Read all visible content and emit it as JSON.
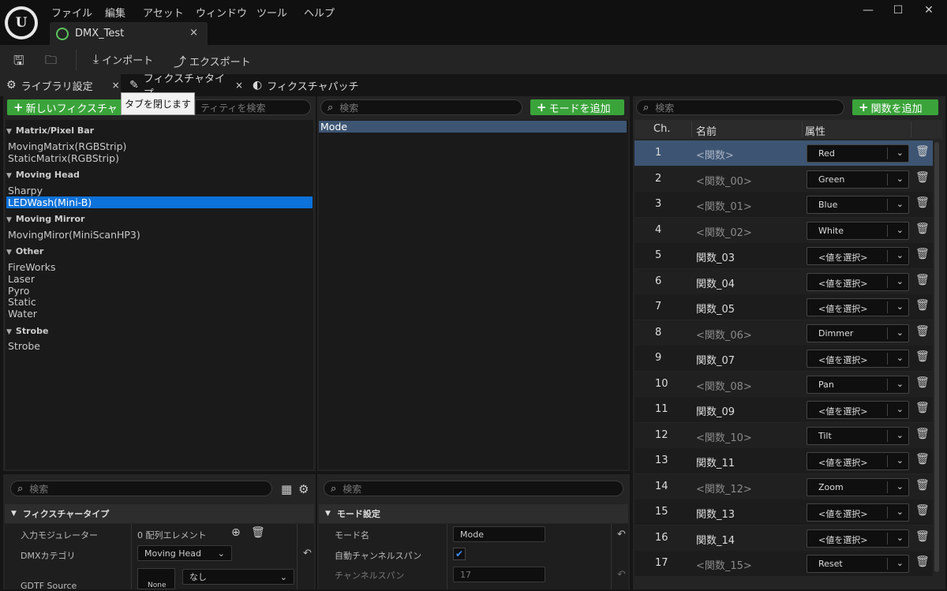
{
  "menu": [
    "ファイル",
    "編集",
    "アセット",
    "ウィンドウ",
    "ツール",
    "ヘルプ"
  ],
  "document_tab": {
    "label": "DMX_Test",
    "close": "×"
  },
  "window_buttons": {
    "minimize": "—",
    "maximize": "☐",
    "close": "✕"
  },
  "toolbar": {
    "import": "インポート",
    "export": "エクスポート"
  },
  "panel_tabs": [
    {
      "label": "ライブラリ設定",
      "close": "×"
    },
    {
      "label": "フィクスチャタイプ",
      "close": "×"
    },
    {
      "label": "フィクスチャパッチ"
    }
  ],
  "tooltip": "タブを閉じます",
  "fixture_list": {
    "new_button": "新しいフィクスチャ",
    "search_placeholder": "ティティを検索",
    "categories": [
      {
        "name": "Matrix/Pixel Bar",
        "items": [
          "MovingMatrix(RGBStrip)",
          "StaticMatrix(RGBStrip)"
        ]
      },
      {
        "name": "Moving Head",
        "items": [
          "Sharpy",
          "LEDWash(Mini-B)"
        ]
      },
      {
        "name": "Moving Mirror",
        "items": [
          "MovingMiror(MiniScanHP3)"
        ]
      },
      {
        "name": "Other",
        "items": [
          "FireWorks",
          "Laser",
          "Pyro",
          "Static",
          "Water"
        ]
      },
      {
        "name": "Strobe",
        "items": [
          "Strobe"
        ]
      }
    ],
    "selected": "LEDWash(Mini-B)"
  },
  "modes": {
    "search_placeholder": "検索",
    "add_button": "モードを追加",
    "items": [
      "Mode"
    ]
  },
  "functions": {
    "search_placeholder": "検索",
    "add_button": "関数を追加",
    "headers": {
      "ch": "Ch.",
      "name": "名前",
      "attribute": "属性"
    },
    "rows": [
      {
        "ch": "1",
        "name": "<関数>",
        "attr": "Red"
      },
      {
        "ch": "2",
        "name": "<関数_00>",
        "attr": "Green"
      },
      {
        "ch": "3",
        "name": "<関数_01>",
        "attr": "Blue"
      },
      {
        "ch": "4",
        "name": "<関数_02>",
        "attr": "White"
      },
      {
        "ch": "5",
        "name": "関数_03",
        "attr": "<値を選択>"
      },
      {
        "ch": "6",
        "name": "関数_04",
        "attr": "<値を選択>"
      },
      {
        "ch": "7",
        "name": "関数_05",
        "attr": "<値を選択>"
      },
      {
        "ch": "8",
        "name": "<関数_06>",
        "attr": "Dimmer"
      },
      {
        "ch": "9",
        "name": "関数_07",
        "attr": "<値を選択>"
      },
      {
        "ch": "10",
        "name": "<関数_08>",
        "attr": "Pan"
      },
      {
        "ch": "11",
        "name": "関数_09",
        "attr": "<値を選択>"
      },
      {
        "ch": "12",
        "name": "<関数_10>",
        "attr": "Tilt"
      },
      {
        "ch": "13",
        "name": "関数_11",
        "attr": "<値を選択>"
      },
      {
        "ch": "14",
        "name": "<関数_12>",
        "attr": "Zoom"
      },
      {
        "ch": "15",
        "name": "関数_13",
        "attr": "<値を選択>"
      },
      {
        "ch": "16",
        "name": "関数_14",
        "attr": "<値を選択>"
      },
      {
        "ch": "17",
        "name": "<関数_15>",
        "attr": "Reset"
      }
    ]
  },
  "details_left": {
    "search_placeholder": "検索",
    "section": "フィクスチャータイプ",
    "props": [
      {
        "label": "入力モジュレーター",
        "value": "0 配列エレメント"
      },
      {
        "label": "DMXカテゴリ",
        "value": "Moving Head"
      },
      {
        "label": "GDTF Source",
        "value": "None",
        "extra": "なし"
      }
    ]
  },
  "details_mid": {
    "search_placeholder": "検索",
    "section": "モード設定",
    "props": [
      {
        "label": "モード名",
        "value": "Mode"
      },
      {
        "label": "自動チャンネルスパン",
        "value": "✔"
      },
      {
        "label": "チャンネルスパン",
        "value": "17"
      }
    ]
  }
}
